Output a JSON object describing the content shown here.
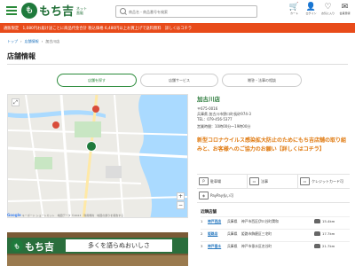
{
  "header": {
    "logo_mark": "も",
    "logo_text": "もち吉",
    "logo_sub": "ネット\n直販",
    "search_placeholder": "商品名・商品番号を検索",
    "icons": [
      {
        "name": "cart-icon",
        "glyph": "🛒",
        "label": "カート"
      },
      {
        "name": "user-icon",
        "glyph": "👤",
        "label": "ログイン"
      },
      {
        "name": "heart-icon",
        "glyph": "♡",
        "label": "お気に入り"
      },
      {
        "name": "mail-icon",
        "glyph": "✉",
        "label": "会員登録"
      }
    ]
  },
  "notice": "通販限定　1,080円お届け送ことに商品代金合計 税込価格 6,480円以上お買上げで送料無料　詳しくはコチラ",
  "breadcrumb": [
    "トップ",
    "店舗情報",
    "加古川店"
  ],
  "page_title": "店舗情報",
  "tabs": [
    "店舗を探す",
    "店舗サービス",
    "贈答・法事の相談"
  ],
  "map": {
    "zoom_in": "+",
    "zoom_out": "−",
    "footer_brand": "Google",
    "footer_text": "キーボード ショートカット　地図データ ©2023　利用規約　地図の誤りを報告する"
  },
  "store": {
    "name": "加古川店",
    "postal": "〒675-0016",
    "address": "兵庫県 加古川市野口町長砂974-3",
    "tel": "TEL：079-456-5377",
    "hours": "営業時間：10時00分〜19時00分",
    "covid": "新型コロナウイルス感染拡大防止のためにもち吉店舗の取り組みと、お客様へのご協力のお願い【詳しくはコチラ】"
  },
  "photo": {
    "sign_text": "もち吉",
    "sign_box": "多くを語らぬおいしさ"
  },
  "features": [
    {
      "icon": "P",
      "label": "駐車場"
    },
    {
      "icon": "▭",
      "label": "法事"
    },
    {
      "icon": "▭",
      "label": "クレジットカード可"
    },
    {
      "icon": "◈",
      "label": "PayPay払い可"
    }
  ],
  "nearby_title": "近隣店舗",
  "nearby": [
    {
      "num": "1",
      "name": "神戸西店",
      "pref": "兵庫県",
      "addr": "神戸市西区伊川谷町潤和",
      "dist": "15.4km"
    },
    {
      "num": "2",
      "name": "姫路店",
      "pref": "兵庫県",
      "addr": "姫路市飾磨区三宅町",
      "dist": "17.7km"
    },
    {
      "num": "3",
      "name": "神戸垂水",
      "pref": "兵庫県",
      "addr": "神戸市垂水区名谷町",
      "dist": "21.7km"
    }
  ]
}
